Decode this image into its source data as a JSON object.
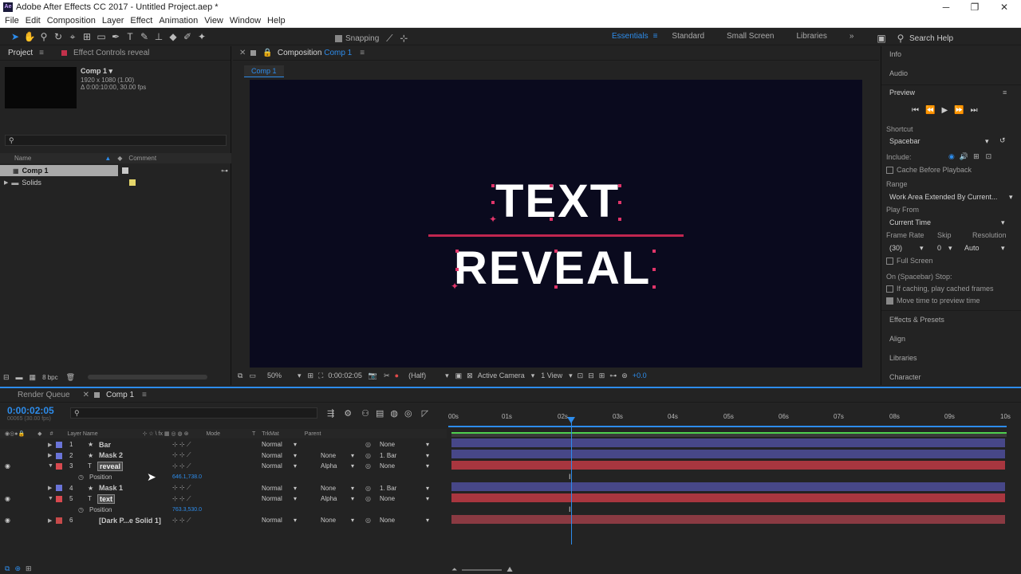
{
  "window": {
    "title": "Adobe After Effects CC 2017 - Untitled Project.aep *",
    "logo": "Ae",
    "minimize": "─",
    "maximize": "❐",
    "close": "✕"
  },
  "menu": [
    "File",
    "Edit",
    "Composition",
    "Layer",
    "Effect",
    "Animation",
    "View",
    "Window",
    "Help"
  ],
  "toolbar": {
    "snapping_label": "Snapping",
    "workspaces": [
      "Essentials",
      "Standard",
      "Small Screen",
      "Libraries"
    ],
    "active_workspace": "Essentials",
    "search_placeholder": "Search Help",
    "more": "»"
  },
  "project": {
    "tab_project": "Project",
    "tab_effect_controls": "Effect Controls reveal",
    "comp_name": "Comp 1 ▾",
    "comp_size": "1920 x 1080 (1.00)",
    "comp_duration": "Δ 0:00:10:00, 30.00 fps",
    "col_name": "Name",
    "col_comment": "Comment",
    "items": [
      {
        "name": "Comp 1",
        "label_color": "#c8c8c8"
      },
      {
        "name": "Solids",
        "label_color": "#e5d66a"
      }
    ],
    "bpc": "8 bpc"
  },
  "composition": {
    "tab_label": "Composition",
    "tab_comp": "Comp 1",
    "breadcrumb": "Comp 1",
    "line1": "TEXT",
    "line2": "REVEAL",
    "zoom": "50%",
    "timecode": "0:00:02:05",
    "resolution": "(Half)",
    "camera": "Active Camera",
    "views": "1 View",
    "exposure": "+0.0"
  },
  "right": {
    "info": "Info",
    "audio": "Audio",
    "preview": "Preview",
    "shortcut_label": "Shortcut",
    "shortcut_value": "Spacebar",
    "include_label": "Include:",
    "cache_label": "Cache Before Playback",
    "range_label": "Range",
    "range_value": "Work Area Extended By Current...",
    "play_from_label": "Play From",
    "play_from_value": "Current Time",
    "frame_rate_label": "Frame Rate",
    "skip_label": "Skip",
    "resolution_label": "Resolution",
    "frame_rate_value": "(30)",
    "skip_value": "0",
    "resolution_value": "Auto",
    "full_screen": "Full Screen",
    "on_stop_label": "On (Spacebar) Stop:",
    "if_caching": "If caching, play cached frames",
    "move_time": "Move time to preview time",
    "effects_presets": "Effects & Presets",
    "align": "Align",
    "libraries": "Libraries",
    "character": "Character"
  },
  "timeline": {
    "tab_render": "Render Queue",
    "tab_comp": "Comp 1",
    "timecode": "0:00:02:05",
    "frame_info": "00065 (30.00 fps)",
    "col_layer_name": "Layer Name",
    "col_mode": "Mode",
    "col_t": "T",
    "col_trkmat": "TrkMat",
    "col_parent": "Parent",
    "ruler": [
      "00s",
      "01s",
      "02s",
      "03s",
      "04s",
      "05s",
      "06s",
      "07s",
      "08s",
      "09s",
      "10s"
    ],
    "layers": [
      {
        "num": "1",
        "type": "★",
        "name": "Bar",
        "color": "#6a74d8",
        "mode": "Normal",
        "trkmat": "",
        "parent": "None",
        "bar": "#4a4a8a"
      },
      {
        "num": "2",
        "type": "★",
        "name": "Mask 2",
        "color": "#6a74d8",
        "mode": "Normal",
        "trkmat": "None",
        "parent": "1. Bar",
        "bar": "#4a4a8a"
      },
      {
        "num": "3",
        "type": "T",
        "name": "reveal",
        "color": "#d8494f",
        "mode": "Normal",
        "trkmat": "Alpha",
        "parent": "None",
        "bar": "#a8363f",
        "selected": true
      },
      {
        "num": "",
        "type": "",
        "name": "Position",
        "color": "",
        "mode": "",
        "trkmat": "",
        "parent": "",
        "prop_value": "646.1,738.0"
      },
      {
        "num": "4",
        "type": "★",
        "name": "Mask 1",
        "color": "#6a74d8",
        "mode": "Normal",
        "trkmat": "None",
        "parent": "1. Bar",
        "bar": "#4a4a8a"
      },
      {
        "num": "5",
        "type": "T",
        "name": "text",
        "color": "#d8494f",
        "mode": "Normal",
        "trkmat": "Alpha",
        "parent": "None",
        "bar": "#a8363f",
        "selected": true
      },
      {
        "num": "",
        "type": "",
        "name": "Position",
        "color": "",
        "mode": "",
        "trkmat": "",
        "parent": "",
        "prop_value": "763.3,530.0"
      },
      {
        "num": "6",
        "type": "",
        "name": "[Dark P...e Solid 1]",
        "color": "#c74a4a",
        "mode": "Normal",
        "trkmat": "None",
        "parent": "None",
        "bar": "#9a3a40"
      }
    ]
  },
  "colors": {
    "accent": "#2d8ceb",
    "panel": "#232323",
    "viewer_bg": "#0a0a1e",
    "handle": "#e0356a",
    "bar_line": "#c0264f"
  }
}
